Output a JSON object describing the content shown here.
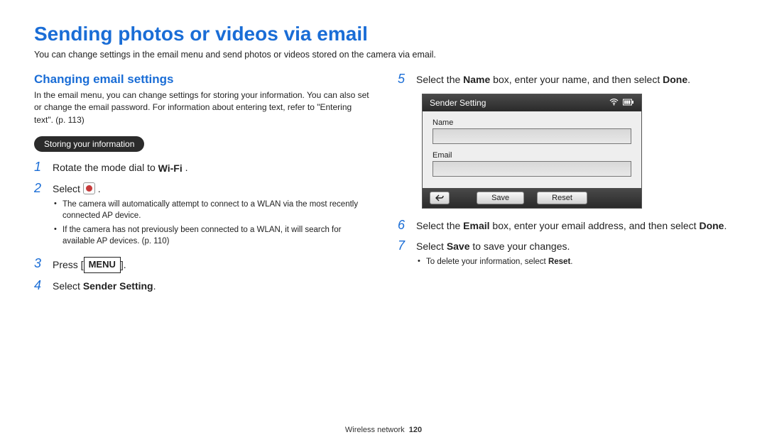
{
  "page_title": "Sending photos or videos via email",
  "page_intro": "You can change settings in the email menu and send photos or videos stored on the camera via email.",
  "left": {
    "heading": "Changing email settings",
    "intro": "In the email menu, you can change settings for storing your information. You can also set or change the email password. For information about entering text, refer to \"Entering text\". (p. 113)",
    "pill": "Storing your information",
    "steps": {
      "s1_pre": "Rotate the mode dial to ",
      "wifi_label": "Wi-Fi",
      "s1_post": " .",
      "s2_pre": "Select ",
      "s2_post": " .",
      "s2_bullets": [
        "The camera will automatically attempt to connect to a WLAN via the most recently connected AP device.",
        "If the camera has not previously been connected to a WLAN, it will search for available AP devices. (p. 110)"
      ],
      "s3_pre": "Press [",
      "menu_label": "MENU",
      "s3_post": "].",
      "s4_pre": "Select ",
      "s4_bold": "Sender Setting",
      "s4_post": "."
    }
  },
  "right": {
    "s5_pre": "Select the ",
    "s5_b1": "Name",
    "s5_mid": " box, enter your name, and then select ",
    "s5_b2": "Done",
    "s5_post": ".",
    "shot": {
      "title": "Sender Setting",
      "name_label": "Name",
      "email_label": "Email",
      "save_label": "Save",
      "reset_label": "Reset"
    },
    "s6_pre": "Select the ",
    "s6_b1": "Email",
    "s6_mid": " box, enter your email address, and then select ",
    "s6_b2": "Done",
    "s6_post": ".",
    "s7_pre": "Select ",
    "s7_b1": "Save",
    "s7_post": " to save your changes.",
    "s7_bullets_pre": "To delete your information, select ",
    "s7_bullets_b": "Reset",
    "s7_bullets_post": "."
  },
  "footer": {
    "section": "Wireless network",
    "page": "120"
  }
}
